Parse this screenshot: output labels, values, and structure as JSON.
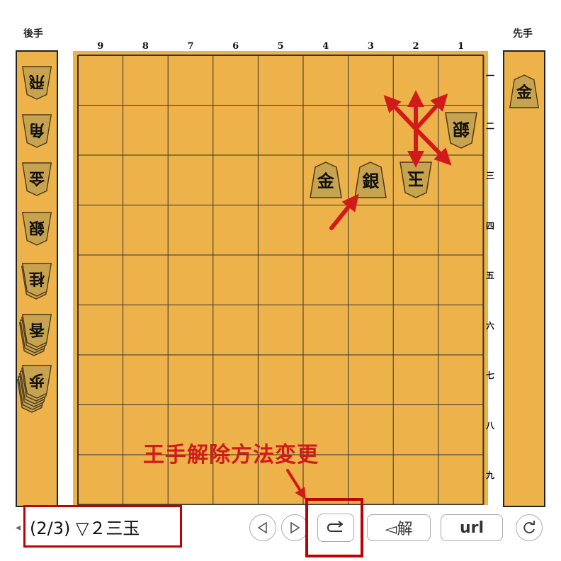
{
  "players": {
    "gote": "後手",
    "sente": "先手"
  },
  "files": [
    "9",
    "8",
    "7",
    "6",
    "5",
    "4",
    "3",
    "2",
    "1"
  ],
  "ranks": [
    "一",
    "二",
    "三",
    "四",
    "五",
    "六",
    "七",
    "八",
    "九"
  ],
  "board_pieces": [
    {
      "ch": "金",
      "file": 4,
      "rank": 3,
      "side": "sente"
    },
    {
      "ch": "銀",
      "file": 3,
      "rank": 3,
      "side": "sente"
    },
    {
      "ch": "玉",
      "file": 2,
      "rank": 3,
      "side": "gote"
    },
    {
      "ch": "銀",
      "file": 1,
      "rank": 2,
      "side": "gote"
    }
  ],
  "gote_hand": [
    {
      "ch": "飛",
      "count": 1
    },
    {
      "ch": "角",
      "count": 1
    },
    {
      "ch": "金",
      "count": 1
    },
    {
      "ch": "銀",
      "count": 1
    },
    {
      "ch": "桂",
      "count": 2
    },
    {
      "ch": "香",
      "count": 4
    },
    {
      "ch": "歩",
      "count": 6
    }
  ],
  "sente_hand": [
    {
      "ch": "金",
      "count": 1
    }
  ],
  "annotation": {
    "text": "王手解除方法変更",
    "color": "#d11a1a"
  },
  "status": {
    "move_text": "(2/3) ▽２三玉"
  },
  "controls": {
    "prev_icon": "triangle-left-icon",
    "next_icon": "triangle-right-icon",
    "redo_icon": "redo-arrow-icon",
    "solve_label": "◅解",
    "url_label": "url",
    "refresh_icon": "refresh-icon"
  },
  "colors": {
    "board": "#eeb24a",
    "piece": "#c7a24f",
    "accent": "#c00000"
  }
}
